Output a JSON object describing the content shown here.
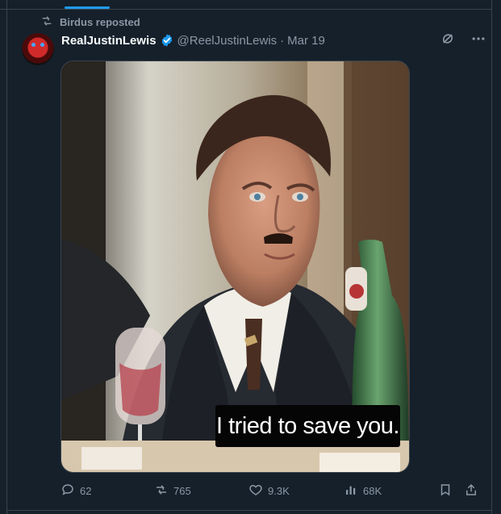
{
  "repost": {
    "text": "Birdus reposted"
  },
  "post": {
    "author": {
      "display_name": "RealJustinLewis",
      "handle": "@ReelJustinLewis",
      "separator": "·",
      "date": "Mar 19",
      "verified": true
    },
    "media": {
      "caption": "I tried to save you."
    },
    "actions": {
      "replies": "62",
      "reposts": "765",
      "likes": "9.3K",
      "views": "68K"
    }
  },
  "colors": {
    "background": "#15202b",
    "text": "#f7f9f9",
    "muted": "#8b98a5",
    "accent": "#1d9bf0"
  },
  "icons": {
    "repost": "repost-icon",
    "verified": "verified-badge-icon",
    "grok": "grok-icon",
    "more": "more-icon",
    "reply": "reply-icon",
    "like": "heart-icon",
    "views": "views-icon",
    "bookmark": "bookmark-icon",
    "share": "share-icon"
  }
}
